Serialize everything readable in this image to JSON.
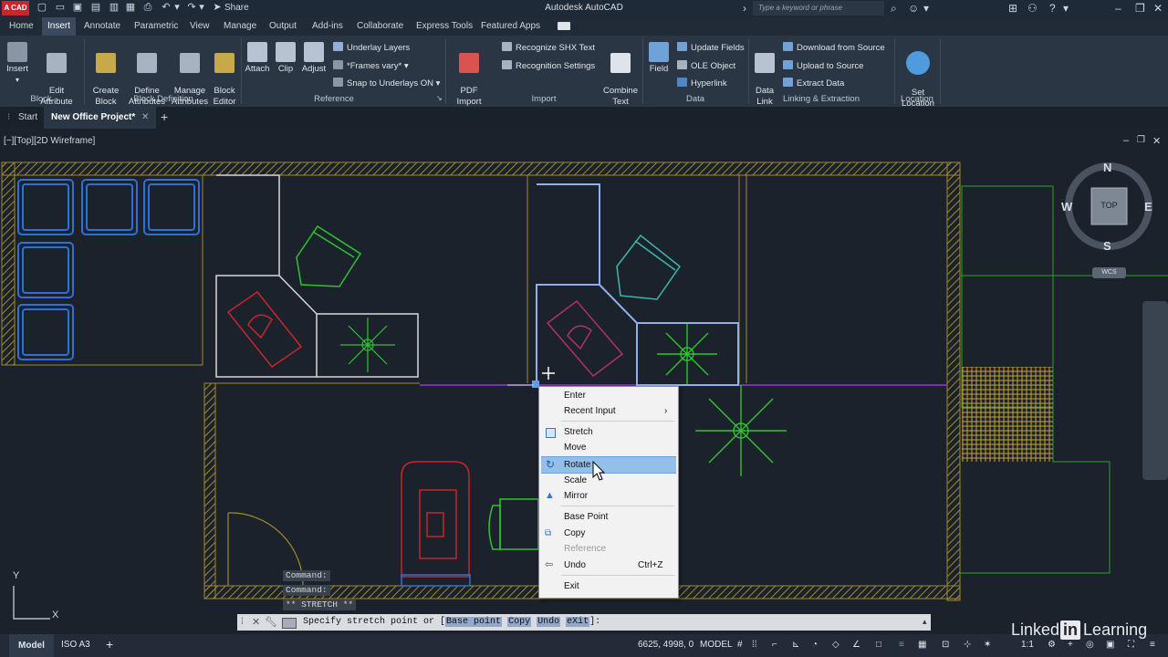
{
  "app": {
    "logo": "A CAD",
    "title": "Autodesk AutoCAD",
    "share": "Share",
    "search_placeholder": "Type a keyword or phrase"
  },
  "ribbon_tabs": [
    "Home",
    "Insert",
    "Annotate",
    "Parametric",
    "View",
    "Manage",
    "Output",
    "Add-ins",
    "Collaborate",
    "Express Tools",
    "Featured Apps"
  ],
  "ribbon": {
    "block": {
      "insert": "Insert",
      "edit_attribute": "Edit\nAttribute",
      "label": "Block"
    },
    "block_definition": {
      "create_block": "Create\nBlock",
      "define_attributes": "Define\nAttributes",
      "manage_attributes": "Manage\nAttributes",
      "block_editor": "Block\nEditor",
      "label": "Block Definition"
    },
    "reference": {
      "attach": "Attach",
      "clip": "Clip",
      "adjust": "Adjust",
      "underlay_layers": "Underlay Layers",
      "frames_vary": "*Frames vary*",
      "snap_to_underlays": "Snap to Underlays ON",
      "label": "Reference"
    },
    "import": {
      "pdf_import": "PDF\nImport",
      "recognize_shx": "Recognize SHX Text",
      "recognition_settings": "Recognition Settings",
      "combine_text": "Combine\nText",
      "label": "Import"
    },
    "data": {
      "field": "Field",
      "update_fields": "Update Fields",
      "ole_object": "OLE Object",
      "hyperlink": "Hyperlink",
      "data_link": "Data\nLink",
      "label": "Data"
    },
    "linking": {
      "download": "Download from Source",
      "upload": "Upload to Source",
      "extract": "Extract  Data",
      "label": "Linking & Extraction"
    },
    "location": {
      "set_location": "Set\nLocation",
      "label": "Location"
    }
  },
  "doc_tabs": {
    "start": "Start",
    "active": "New Office Project*",
    "add": "+"
  },
  "viewport": {
    "label": "[−][Top][2D Wireframe]"
  },
  "viewcube": {
    "n": "N",
    "s": "S",
    "e": "E",
    "w": "W",
    "top": "TOP",
    "wcs": "WCS"
  },
  "ucs": {
    "x": "X",
    "y": "Y"
  },
  "command": {
    "history": [
      "Command:",
      "Command:",
      "** STRETCH **"
    ],
    "prompt_prefix": "Specify stretch point or [",
    "options": [
      "Base point",
      "Copy",
      "Undo",
      "eXit"
    ],
    "prompt_suffix": "]:"
  },
  "context_menu": [
    {
      "label": "Enter",
      "shortcut": "",
      "icon": "",
      "state": "normal"
    },
    {
      "label": "Recent Input",
      "shortcut": "›",
      "icon": "",
      "state": "normal"
    },
    {
      "label": "Stretch",
      "shortcut": "",
      "icon": "stretch-icon",
      "state": "normal"
    },
    {
      "label": "Move",
      "shortcut": "",
      "icon": "",
      "state": "normal"
    },
    {
      "label": "Rotate",
      "shortcut": "",
      "icon": "rotate-icon",
      "state": "selected"
    },
    {
      "label": "Scale",
      "shortcut": "",
      "icon": "",
      "state": "normal"
    },
    {
      "label": "Mirror",
      "shortcut": "",
      "icon": "mirror-icon",
      "state": "normal"
    },
    {
      "label": "Base Point",
      "shortcut": "",
      "icon": "",
      "state": "normal"
    },
    {
      "label": "Copy",
      "shortcut": "",
      "icon": "copy-icon",
      "state": "normal"
    },
    {
      "label": "Reference",
      "shortcut": "",
      "icon": "",
      "state": "disabled"
    },
    {
      "label": "Undo",
      "shortcut": "Ctrl+Z",
      "icon": "undo-icon",
      "state": "normal"
    },
    {
      "label": "Exit",
      "shortcut": "",
      "icon": "",
      "state": "normal"
    }
  ],
  "status_bar": {
    "model_tab": "Model",
    "layout_tab": "ISO A3",
    "add": "+",
    "coords": "6625, 4998, 0",
    "mode": "MODEL",
    "scale": "1:1"
  },
  "watermark": {
    "text": "Linked",
    "badge": "in",
    "suffix": "Learning"
  },
  "colors": {
    "accent": "#93bfea",
    "wall": "#a08a2a",
    "furniture_blue": "#2f6fd6",
    "plant_green": "#2ec42e"
  }
}
